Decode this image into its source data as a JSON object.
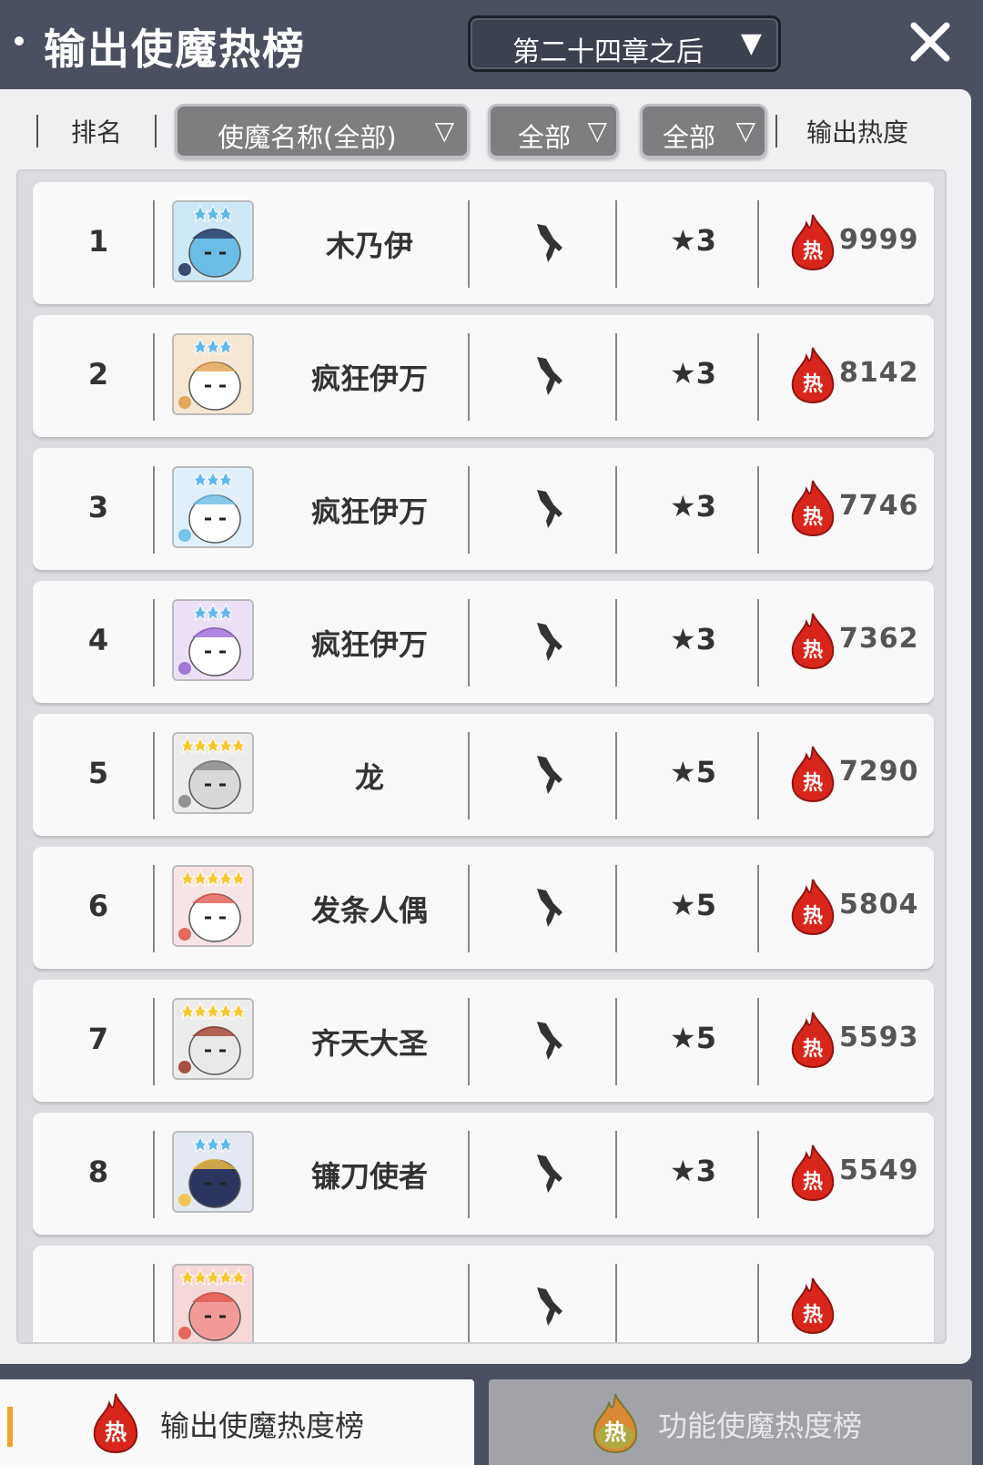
{
  "header": {
    "title": "输出使魔热榜",
    "chapter_select": "第二十四章之后",
    "dropdown_arrow": "▼",
    "close_label": "close"
  },
  "columns": {
    "rank": "排名",
    "name_filter": "使魔名称(全部)",
    "filter_two": "全部",
    "filter_three": "全部",
    "heat": "输出热度",
    "filter_arrow": "▽"
  },
  "rows": [
    {
      "rank": "1",
      "name": "木乃伊",
      "stars": "★3",
      "heat": "9999",
      "avatar": "mummy-blue",
      "star_count": 3
    },
    {
      "rank": "2",
      "name": "疯狂伊万",
      "stars": "★3",
      "heat": "8142",
      "avatar": "rabbit-orange",
      "star_count": 3
    },
    {
      "rank": "3",
      "name": "疯狂伊万",
      "stars": "★3",
      "heat": "7746",
      "avatar": "rabbit-blue",
      "star_count": 3
    },
    {
      "rank": "4",
      "name": "疯狂伊万",
      "stars": "★3",
      "heat": "7362",
      "avatar": "rabbit-purple",
      "star_count": 3
    },
    {
      "rank": "5",
      "name": "龙",
      "stars": "★5",
      "heat": "7290",
      "avatar": "dragon-grey",
      "star_count": 5
    },
    {
      "rank": "6",
      "name": "发条人偶",
      "stars": "★5",
      "heat": "5804",
      "avatar": "doll-red",
      "star_count": 5
    },
    {
      "rank": "7",
      "name": "齐天大圣",
      "stars": "★5",
      "heat": "5593",
      "avatar": "monkey-white",
      "star_count": 5
    },
    {
      "rank": "8",
      "name": "镰刀使者",
      "stars": "★3",
      "heat": "5549",
      "avatar": "reaper-yellow",
      "star_count": 3
    },
    {
      "rank": "",
      "name": "",
      "stars": "",
      "heat": "",
      "avatar": "pink-partial",
      "star_count": 5
    }
  ],
  "icons": {
    "type": "sword-attack-icon",
    "heat": "fire-heat-icon",
    "heat_glyph": "热"
  },
  "footer": {
    "tab_output": "输出使魔热度榜",
    "tab_function": "功能使魔热度榜"
  },
  "colors": {
    "background": "#4b5060",
    "heat_red": "#d9261c",
    "accent_orange": "#f2a32a"
  }
}
